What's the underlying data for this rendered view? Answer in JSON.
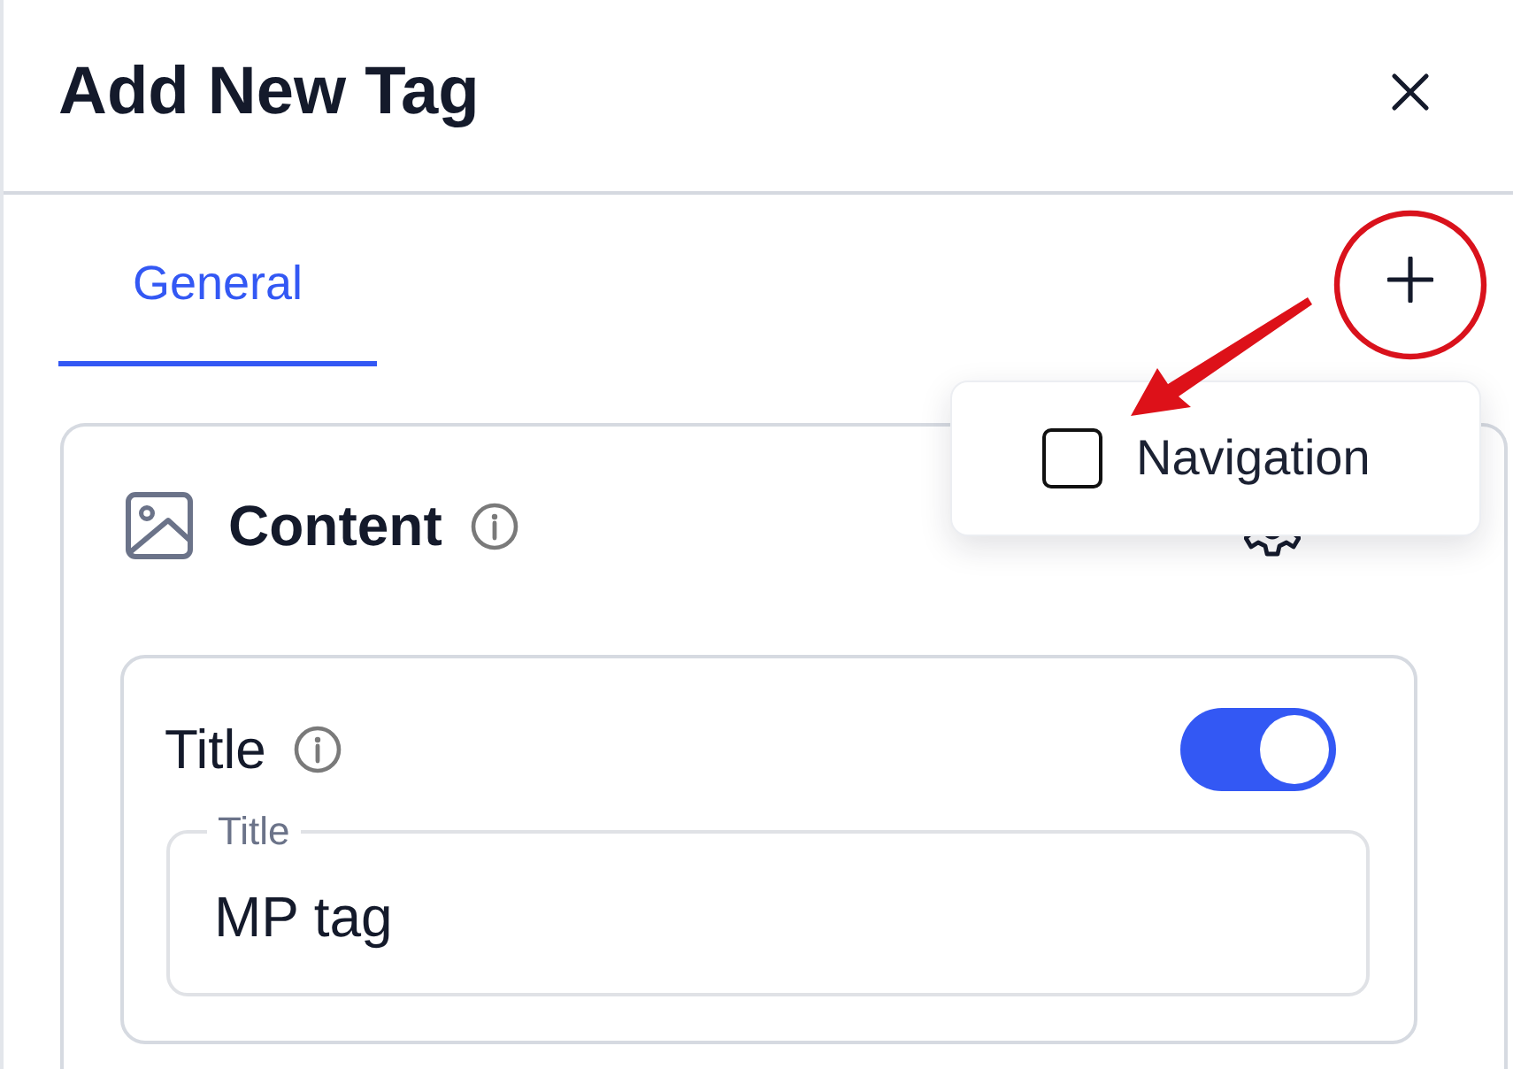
{
  "header": {
    "title": "Add New Tag"
  },
  "tabs": [
    {
      "label": "General",
      "selected": true
    }
  ],
  "add_menu": {
    "items": [
      {
        "label": "Navigation",
        "checked": false
      }
    ]
  },
  "content_section": {
    "title": "Content",
    "fields": [
      {
        "label": "Title",
        "enabled": true,
        "input": {
          "label": "Title",
          "value": "MP tag"
        }
      }
    ]
  }
}
